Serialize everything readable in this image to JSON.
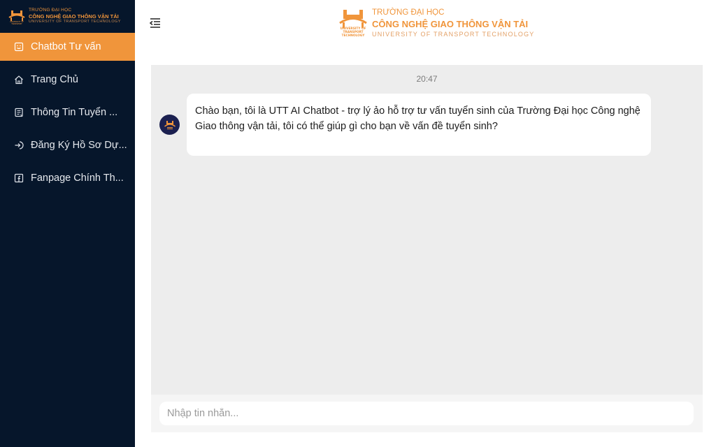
{
  "brand": {
    "line1": "TRƯỜNG ĐẠI HỌC",
    "line2": "CÔNG NGHỆ GIAO THÔNG VẬN TẢI",
    "line3": "UNIVERSITY OF TRANSPORT TECHNOLOGY",
    "accent_color": "#f0953b",
    "sidebar_bg": "#06162b"
  },
  "sidebar": {
    "items": [
      {
        "label": "Chatbot Tư vấn",
        "icon": "chat-icon",
        "active": true
      },
      {
        "label": "Trang Chủ",
        "icon": "home-icon",
        "active": false
      },
      {
        "label": "Thông Tin Tuyển ...",
        "icon": "document-icon",
        "active": false
      },
      {
        "label": "Đăng Ký Hồ Sơ Dự...",
        "icon": "login-icon",
        "active": false
      },
      {
        "label": "Fanpage Chính Th...",
        "icon": "facebook-icon",
        "active": false
      }
    ]
  },
  "header": {
    "toggle_icon": "menu-collapse-icon"
  },
  "chat": {
    "timestamp": "20:47",
    "messages": [
      {
        "sender": "bot",
        "text": "Chào bạn, tôi là UTT AI Chatbot - trợ lý ảo hỗ trợ tư vấn tuyển sinh của Trường Đại học Công nghệ Giao thông vận tải, tôi có thể giúp gì cho bạn về vấn đề tuyển sinh?"
      }
    ]
  },
  "input": {
    "placeholder": "Nhập tin nhắn...",
    "value": ""
  }
}
